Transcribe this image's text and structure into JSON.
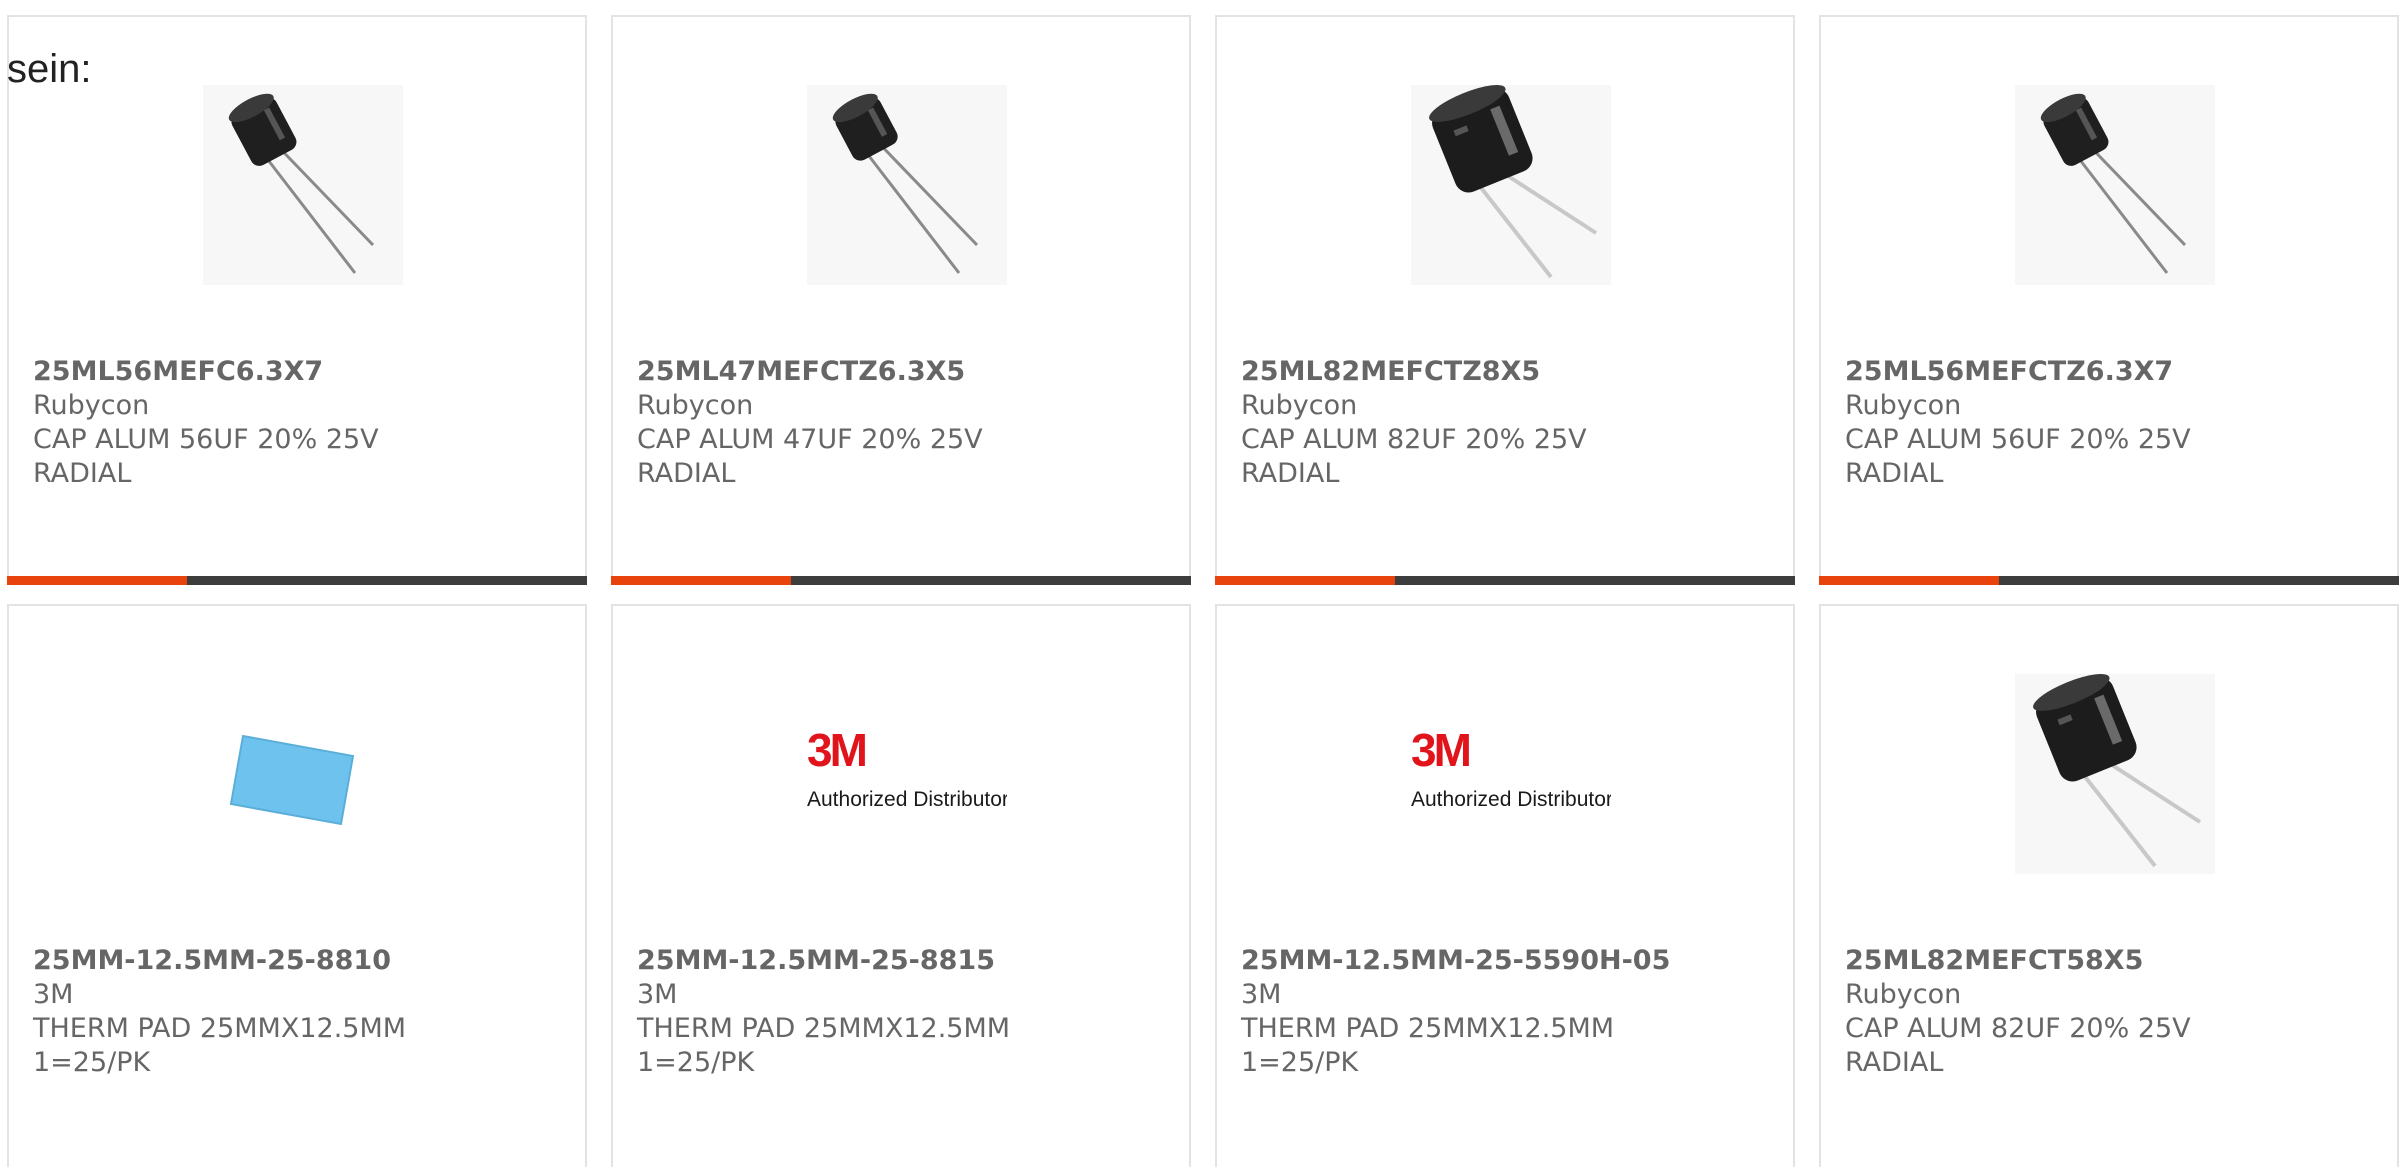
{
  "intro_text": "sein:",
  "accent_color": "#e8420d",
  "products": [
    {
      "part_number": "25ML56MEFC6.3X7",
      "manufacturer": "Rubycon",
      "desc_line1": "CAP ALUM 56UF 20% 25V",
      "desc_line2": "RADIAL",
      "image_icon": "capacitor-small-icon",
      "progress": 0.31
    },
    {
      "part_number": "25ML47MEFCTZ6.3X5",
      "manufacturer": "Rubycon",
      "desc_line1": "CAP ALUM 47UF 20% 25V",
      "desc_line2": "RADIAL",
      "image_icon": "capacitor-small-icon",
      "progress": 0.31
    },
    {
      "part_number": "25ML82MEFCTZ8X5",
      "manufacturer": "Rubycon",
      "desc_line1": "CAP ALUM 82UF 20% 25V",
      "desc_line2": "RADIAL",
      "image_icon": "capacitor-large-icon",
      "progress": 0.31
    },
    {
      "part_number": "25ML56MEFCTZ6.3X7",
      "manufacturer": "Rubycon",
      "desc_line1": "CAP ALUM 56UF 20% 25V",
      "desc_line2": "RADIAL",
      "image_icon": "capacitor-small-icon",
      "progress": 0.31
    },
    {
      "part_number": "25MM-12.5MM-25-8810",
      "manufacturer": "3M",
      "desc_line1": "THERM PAD 25MMX12.5MM",
      "desc_line2": "1=25/PK",
      "image_icon": "thermal-pad-icon"
    },
    {
      "part_number": "25MM-12.5MM-25-8815",
      "manufacturer": "3M",
      "desc_line1": "THERM PAD 25MMX12.5MM",
      "desc_line2": "1=25/PK",
      "image_icon": "3m-logo-icon",
      "logo_text": "3M",
      "logo_caption": "Authorized Distributor"
    },
    {
      "part_number": "25MM-12.5MM-25-5590H-05",
      "manufacturer": "3M",
      "desc_line1": "THERM PAD 25MMX12.5MM",
      "desc_line2": "1=25/PK",
      "image_icon": "3m-logo-icon",
      "logo_text": "3M",
      "logo_caption": "Authorized Distributor"
    },
    {
      "part_number": "25ML82MEFCT58X5",
      "manufacturer": "Rubycon",
      "desc_line1": "CAP ALUM 82UF 20% 25V",
      "desc_line2": "RADIAL",
      "image_icon": "capacitor-large-icon"
    }
  ]
}
